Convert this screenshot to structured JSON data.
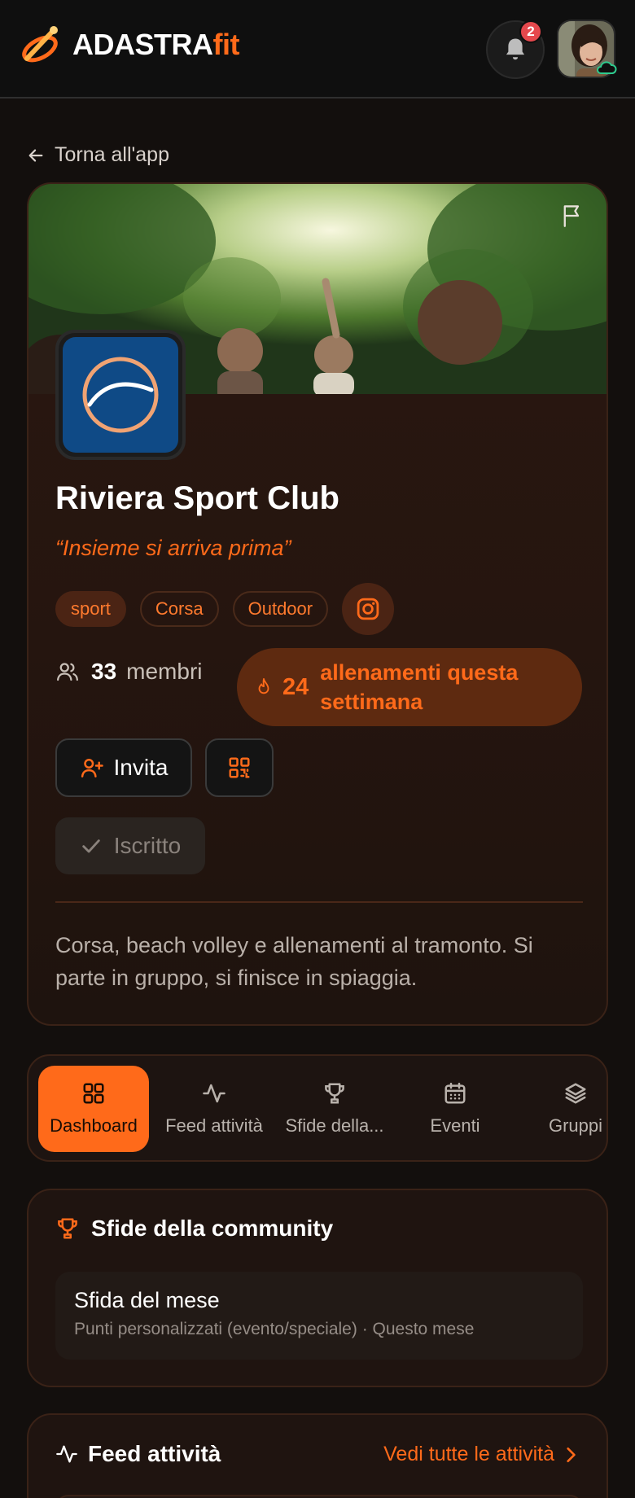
{
  "header": {
    "brand": "ADASTRA",
    "brand_suffix": "fit",
    "notification_count": "2"
  },
  "back_link": "Torna all'app",
  "club": {
    "name": "Riviera Sport Club",
    "motto": "“Insieme si arriva prima”",
    "tags": [
      "sport",
      "Corsa",
      "Outdoor"
    ],
    "members_count": "33",
    "members_label": "membri",
    "trainings_count": "24",
    "trainings_label": "allenamenti questa settimana",
    "invite_label": "Invita",
    "joined_label": "Iscritto",
    "description": "Corsa, beach volley e allenamenti al tramonto. Si parte in gruppo, si finisce in spiaggia."
  },
  "tabs": [
    {
      "label": "Dashboard",
      "icon": "grid-icon",
      "active": true
    },
    {
      "label": "Feed attività",
      "icon": "activity-icon",
      "active": false
    },
    {
      "label": "Sfide della...",
      "icon": "trophy-icon",
      "active": false
    },
    {
      "label": "Eventi",
      "icon": "calendar-icon",
      "active": false
    },
    {
      "label": "Gruppi",
      "icon": "layers-icon",
      "active": false
    }
  ],
  "challenges": {
    "title": "Sfide della community",
    "item_title": "Sfida del mese",
    "item_subtitle": "Punti personalizzati (evento/speciale) · Questo mese"
  },
  "feed": {
    "title": "Feed attività",
    "link": "Vedi tutte le attività"
  },
  "colors": {
    "accent": "#ff6a1a",
    "background": "#130f0d",
    "card": "#25150f",
    "badge": "#e5484d",
    "club_logo_bg": "#0f4a86"
  }
}
